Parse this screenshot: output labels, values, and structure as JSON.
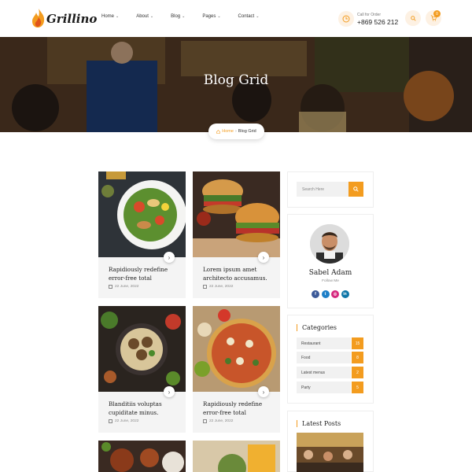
{
  "header": {
    "brand": "Grillino",
    "nav": [
      {
        "label": "Home"
      },
      {
        "label": "About"
      },
      {
        "label": "Blog"
      },
      {
        "label": "Pages"
      },
      {
        "label": "Contact"
      }
    ],
    "call_label": "Call for Order",
    "call_number": "+869 526 212",
    "cart_count": "0"
  },
  "hero": {
    "title": "Blog Grid",
    "breadcrumb_home": "Home",
    "breadcrumb_current": "Blog Grid"
  },
  "posts": [
    {
      "title": "Rapidiously redefine error-free total",
      "date": "22 June, 2022"
    },
    {
      "title": "Lorem ipsum amet architecto accusamus.",
      "date": "22 June, 2022"
    },
    {
      "title": "Blanditiis voluptas cupiditate minus.",
      "date": "22 June, 2022"
    },
    {
      "title": "Rapidiously redefine error-free total",
      "date": "22 June, 2022"
    }
  ],
  "sidebar": {
    "search_placeholder": "Search Here",
    "author_name": "Sabel Adam",
    "author_sub": "Follow Me",
    "socials": [
      "facebook-icon",
      "twitter-icon",
      "instagram-icon",
      "linkedin-icon"
    ],
    "categories_title": "Categories",
    "categories": [
      {
        "name": "Restaurant",
        "count": "15"
      },
      {
        "name": "Food",
        "count": "8"
      },
      {
        "name": "Latest menus",
        "count": "2"
      },
      {
        "name": "Party",
        "count": "5"
      }
    ],
    "latest_title": "Latest Posts"
  },
  "colors": {
    "accent": "#f39c1f"
  }
}
